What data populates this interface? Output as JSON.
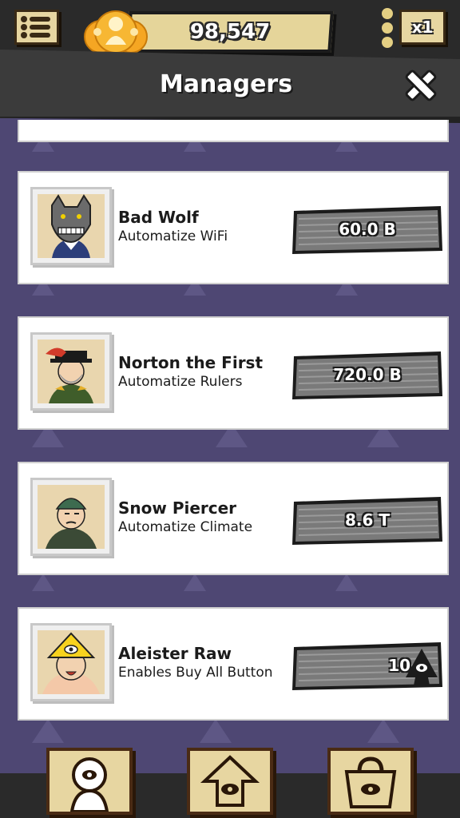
{
  "header": {
    "currency_amount": "98,547",
    "multiplier_label": "x1",
    "title": "Managers"
  },
  "managers": [
    {
      "name": "Bad Wolf",
      "description": "Automatize WiFi",
      "price": "60.0 B",
      "currency": "money"
    },
    {
      "name": "Norton the First",
      "description": "Automatize Rulers",
      "price": "720.0 B",
      "currency": "money"
    },
    {
      "name": "Snow Piercer",
      "description": "Automatize Climate",
      "price": "8.6 T",
      "currency": "money"
    },
    {
      "name": "Aleister Raw",
      "description": "Enables Buy All Button",
      "price": "10",
      "currency": "illuminati-token"
    }
  ],
  "bottom_nav": {
    "items": [
      "managers-icon",
      "upgrades-icon",
      "shop-icon"
    ]
  },
  "colors": {
    "background": "#4e4773",
    "parchment": "#e7d6a1",
    "dark_bar": "#2a2a2a",
    "coin_orange": "#f5a623"
  }
}
